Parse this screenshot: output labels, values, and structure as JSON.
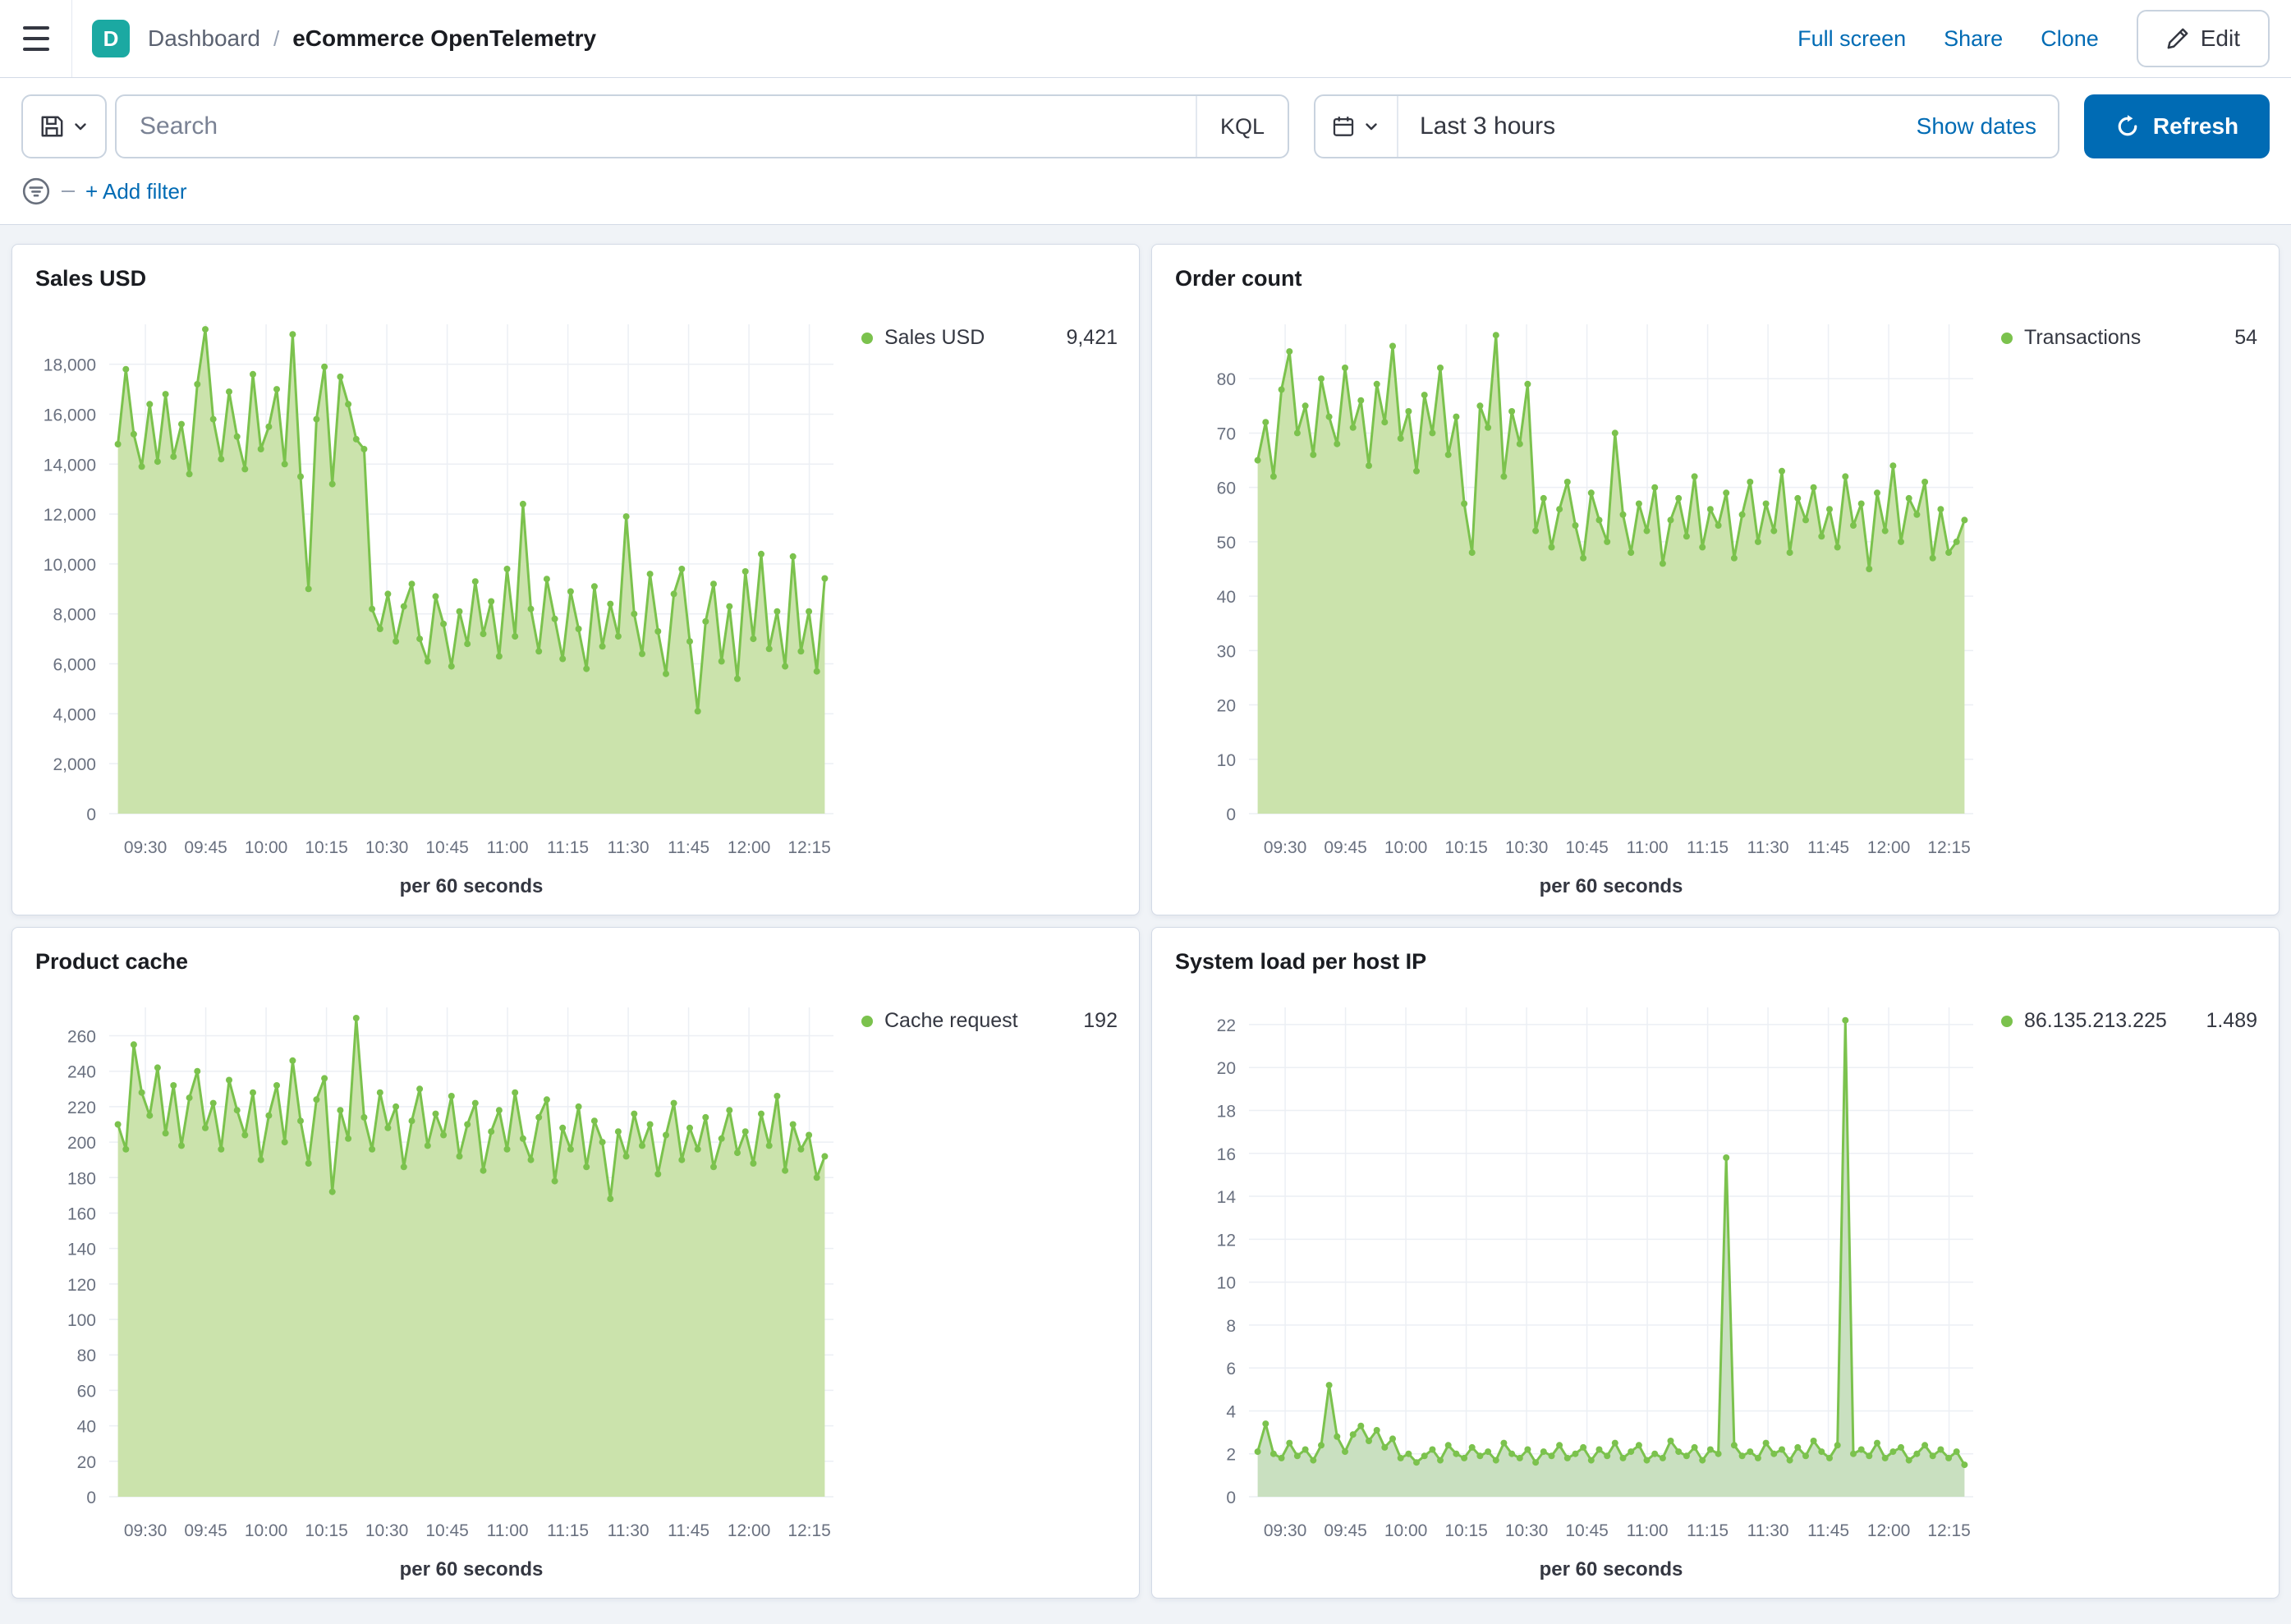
{
  "colors": {
    "primary_blue": "#006BB4",
    "space_badge_bg": "#1BA9A2",
    "panel_border": "#D3DAE6",
    "page_bg": "#F0F3F7",
    "text": "#343741",
    "muted_text": "#69707D",
    "series_green": "#7BC24D"
  },
  "header": {
    "space_badge": "D",
    "breadcrumb_root": "Dashboard",
    "breadcrumb_separator": "/",
    "breadcrumb_current": "eCommerce OpenTelemetry",
    "actions": {
      "full_screen": "Full screen",
      "share": "Share",
      "clone": "Clone",
      "edit": "Edit"
    }
  },
  "query_bar": {
    "search_placeholder": "Search",
    "language": "KQL",
    "time_range": "Last 3 hours",
    "show_dates": "Show dates",
    "refresh": "Refresh"
  },
  "filter_bar": {
    "add_filter": "+ Add filter"
  },
  "chart_data": [
    {
      "type": "area",
      "title": "Sales USD",
      "legend": {
        "label": "Sales USD",
        "value": "9,421"
      },
      "xlabel": "per 60 seconds",
      "x_ticks": [
        "09:30",
        "09:45",
        "10:00",
        "10:15",
        "10:30",
        "10:45",
        "11:00",
        "11:15",
        "11:30",
        "11:45",
        "12:00",
        "12:15"
      ],
      "y_ticks": [
        0,
        2000,
        4000,
        6000,
        8000,
        10000,
        12000,
        14000,
        16000,
        18000
      ],
      "y_tick_labels": [
        "0",
        "2,000",
        "4,000",
        "6,000",
        "8,000",
        "10,000",
        "12,000",
        "14,000",
        "16,000",
        "18,000"
      ],
      "y_max": 19600,
      "line_color": "#7BC24D",
      "fill_color": "#CBE3AC",
      "values": [
        14800,
        17800,
        15200,
        13900,
        16400,
        14100,
        16800,
        14300,
        15600,
        13600,
        17200,
        19400,
        15800,
        14200,
        16900,
        15100,
        13800,
        17600,
        14600,
        15500,
        17000,
        14000,
        19200,
        13500,
        9000,
        15800,
        17900,
        13200,
        17500,
        16400,
        15000,
        14600,
        8200,
        7400,
        8800,
        6900,
        8300,
        9200,
        7000,
        6100,
        8700,
        7600,
        5900,
        8100,
        6800,
        9300,
        7200,
        8500,
        6300,
        9800,
        7100,
        12400,
        8200,
        6500,
        9400,
        7800,
        6200,
        8900,
        7400,
        5800,
        9100,
        6700,
        8400,
        7100,
        11900,
        8000,
        6400,
        9600,
        7300,
        5600,
        8800,
        9800,
        6900,
        4100,
        7700,
        9200,
        6100,
        8300,
        5400,
        9700,
        7000,
        10400,
        6600,
        8100,
        5900,
        10300,
        6500,
        8100,
        5700,
        9421
      ]
    },
    {
      "type": "area",
      "title": "Order count",
      "legend": {
        "label": "Transactions",
        "value": "54"
      },
      "xlabel": "per 60 seconds",
      "x_ticks": [
        "09:30",
        "09:45",
        "10:00",
        "10:15",
        "10:30",
        "10:45",
        "11:00",
        "11:15",
        "11:30",
        "11:45",
        "12:00",
        "12:15"
      ],
      "y_ticks": [
        0,
        10,
        20,
        30,
        40,
        50,
        60,
        70,
        80
      ],
      "y_tick_labels": [
        "0",
        "10",
        "20",
        "30",
        "40",
        "50",
        "60",
        "70",
        "80"
      ],
      "y_max": 90,
      "line_color": "#7BC24D",
      "fill_color": "#CBE3AC",
      "values": [
        65,
        72,
        62,
        78,
        85,
        70,
        75,
        66,
        80,
        73,
        68,
        82,
        71,
        76,
        64,
        79,
        72,
        86,
        69,
        74,
        63,
        77,
        70,
        82,
        66,
        73,
        57,
        48,
        75,
        71,
        88,
        62,
        74,
        68,
        79,
        52,
        58,
        49,
        56,
        61,
        53,
        47,
        59,
        54,
        50,
        70,
        55,
        48,
        57,
        52,
        60,
        46,
        54,
        58,
        51,
        62,
        49,
        56,
        53,
        59,
        47,
        55,
        61,
        50,
        57,
        52,
        63,
        48,
        58,
        54,
        60,
        51,
        56,
        49,
        62,
        53,
        57,
        45,
        59,
        52,
        64,
        50,
        58,
        55,
        61,
        47,
        56,
        48,
        50,
        54
      ]
    },
    {
      "type": "area",
      "title": "Product cache",
      "legend": {
        "label": "Cache request",
        "value": "192"
      },
      "xlabel": "per 60 seconds",
      "x_ticks": [
        "09:30",
        "09:45",
        "10:00",
        "10:15",
        "10:30",
        "10:45",
        "11:00",
        "11:15",
        "11:30",
        "11:45",
        "12:00",
        "12:15"
      ],
      "y_ticks": [
        0,
        20,
        40,
        60,
        80,
        100,
        120,
        140,
        160,
        180,
        200,
        220,
        240,
        260
      ],
      "y_tick_labels": [
        "0",
        "20",
        "40",
        "60",
        "80",
        "100",
        "120",
        "140",
        "160",
        "180",
        "200",
        "220",
        "240",
        "260"
      ],
      "y_max": 276,
      "line_color": "#7BC24D",
      "fill_color": "#CBE3AC",
      "values": [
        210,
        196,
        255,
        228,
        215,
        242,
        205,
        232,
        198,
        225,
        240,
        208,
        222,
        196,
        235,
        218,
        204,
        228,
        190,
        215,
        232,
        200,
        246,
        212,
        188,
        224,
        236,
        172,
        218,
        202,
        270,
        214,
        196,
        228,
        208,
        220,
        186,
        212,
        230,
        198,
        216,
        204,
        226,
        192,
        210,
        222,
        184,
        206,
        218,
        196,
        228,
        202,
        190,
        214,
        224,
        178,
        208,
        196,
        220,
        186,
        212,
        200,
        168,
        206,
        192,
        216,
        198,
        210,
        182,
        204,
        222,
        190,
        208,
        196,
        214,
        186,
        202,
        218,
        194,
        206,
        188,
        216,
        198,
        226,
        184,
        210,
        196,
        204,
        180,
        192
      ]
    },
    {
      "type": "area",
      "title": "System load per host IP",
      "legend": {
        "label": "86.135.213.225",
        "value": "1.489"
      },
      "xlabel": "per 60 seconds",
      "x_ticks": [
        "09:30",
        "09:45",
        "10:00",
        "10:15",
        "10:30",
        "10:45",
        "11:00",
        "11:15",
        "11:30",
        "11:45",
        "12:00",
        "12:15"
      ],
      "y_ticks": [
        0,
        2,
        4,
        6,
        8,
        10,
        12,
        14,
        16,
        18,
        20,
        22
      ],
      "y_tick_labels": [
        "0",
        "2",
        "4",
        "6",
        "8",
        "10",
        "12",
        "14",
        "16",
        "18",
        "20",
        "22"
      ],
      "y_max": 22.8,
      "line_color": "#7BC24D",
      "fill_color": "#C9E0C0",
      "values": [
        2.1,
        3.4,
        2.0,
        1.8,
        2.5,
        1.9,
        2.2,
        1.7,
        2.4,
        5.2,
        2.8,
        2.1,
        2.9,
        3.3,
        2.6,
        3.1,
        2.3,
        2.7,
        1.8,
        2.0,
        1.6,
        1.9,
        2.2,
        1.7,
        2.4,
        2.0,
        1.8,
        2.3,
        1.9,
        2.1,
        1.7,
        2.5,
        2.0,
        1.8,
        2.2,
        1.6,
        2.1,
        1.9,
        2.4,
        1.8,
        2.0,
        2.3,
        1.7,
        2.2,
        1.9,
        2.5,
        1.8,
        2.1,
        2.4,
        1.7,
        2.0,
        1.8,
        2.6,
        2.1,
        1.9,
        2.3,
        1.7,
        2.2,
        2.0,
        15.8,
        2.4,
        1.9,
        2.1,
        1.8,
        2.5,
        2.0,
        2.2,
        1.7,
        2.3,
        1.9,
        2.6,
        2.1,
        1.8,
        2.4,
        22.2,
        2.0,
        2.2,
        1.9,
        2.5,
        1.8,
        2.1,
        2.3,
        1.7,
        2.0,
        2.4,
        1.9,
        2.2,
        1.8,
        2.1,
        1.489
      ]
    }
  ]
}
